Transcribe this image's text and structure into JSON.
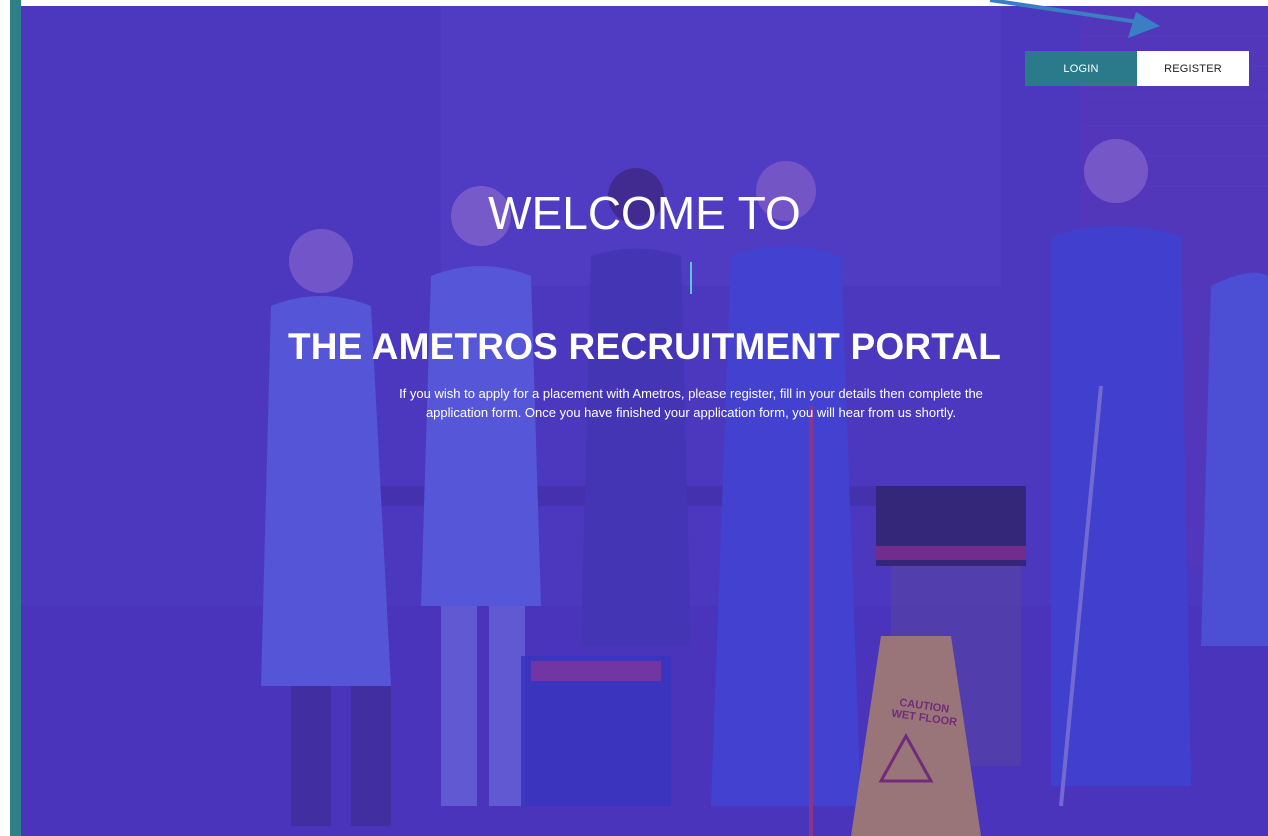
{
  "nav": {
    "login_label": "LOGIN",
    "register_label": "REGISTER"
  },
  "hero": {
    "welcome": "WELCOME TO",
    "title": "THE AMETROS RECRUITMENT PORTAL",
    "intro_line1": "If you wish to apply for a placement with Ametros, please register, fill in your details then complete the",
    "intro_line2": "application form. Once you have finished your application form, you will hear from us shortly.",
    "sign_text_line1": "CAUTION",
    "sign_text_line2": "WET FLOOR",
    "image_icon": "cleaning-team-photo"
  },
  "colors": {
    "accent_teal": "#2b7a8c",
    "left_bar": "#2f7f86",
    "hero_overlay": "#4b36c2",
    "arrow": "#3a7fc4"
  }
}
